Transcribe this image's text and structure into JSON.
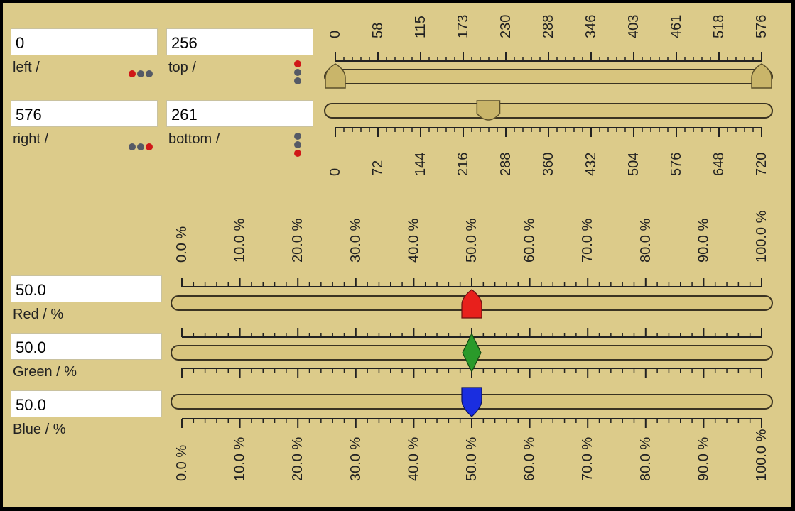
{
  "rect": {
    "left": {
      "value": "0",
      "label": "left /"
    },
    "top": {
      "value": "256",
      "label": "top /"
    },
    "right": {
      "value": "576",
      "label": "right /"
    },
    "bottom": {
      "value": "261",
      "label": "bottom /"
    }
  },
  "horizontal_scale": {
    "min": 0,
    "max": 576,
    "tick_labels": [
      "0",
      "58",
      "115",
      "173",
      "230",
      "288",
      "346",
      "403",
      "461",
      "518",
      "576"
    ],
    "range_low": 0,
    "range_high": 576
  },
  "vertical_scale": {
    "min": 0,
    "max": 720,
    "tick_labels": [
      "0",
      "72",
      "144",
      "216",
      "288",
      "360",
      "432",
      "504",
      "576",
      "648",
      "720"
    ],
    "range_low": 256,
    "range_high": 261
  },
  "color": {
    "red": {
      "value": "50.0",
      "label": "Red / %",
      "level": 50.0,
      "color": "#e8201c"
    },
    "green": {
      "value": "50.0",
      "label": "Green / %",
      "level": 50.0,
      "color": "#2a9a2a"
    },
    "blue": {
      "value": "50.0",
      "label": "Blue / %",
      "level": 50.0,
      "color": "#1a2ee0"
    }
  },
  "percent_scale": {
    "min": 0,
    "max": 100,
    "tick_labels": [
      "0.0 %",
      "10.0 %",
      "20.0 %",
      "30.0 %",
      "40.0 %",
      "50.0 %",
      "60.0 %",
      "70.0 %",
      "80.0 %",
      "90.0 %",
      "100.0 %"
    ]
  },
  "colors": {
    "background": "#dccb8a",
    "track": "#d8c57e",
    "thumb": "#c9b56a"
  }
}
